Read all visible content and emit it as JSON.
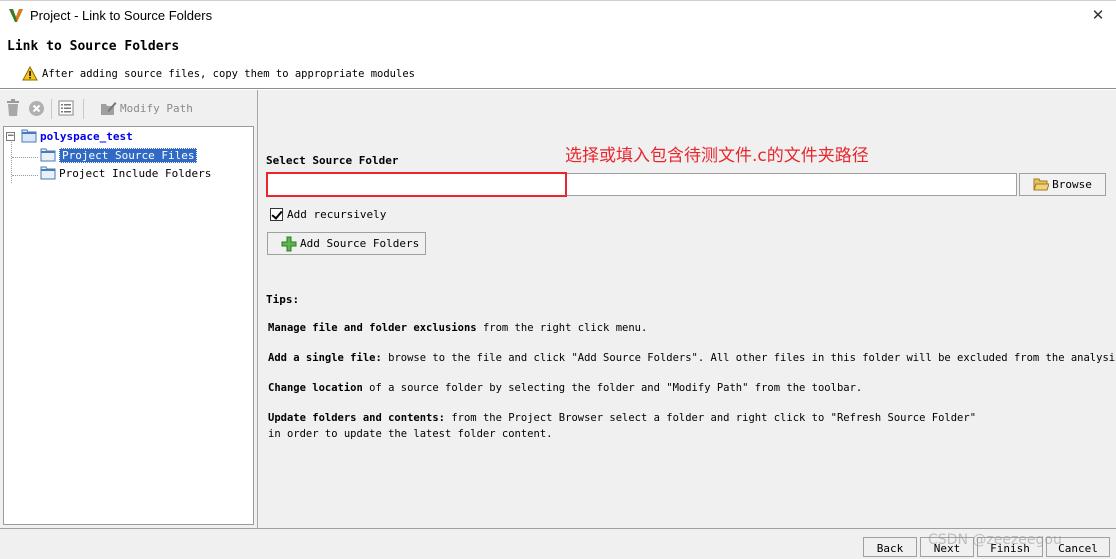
{
  "window": {
    "title": "Project - Link to Source Folders",
    "close_glyph": "✕"
  },
  "banner": {
    "heading": "Link to Source Folders",
    "warning": "After adding source files, copy them to appropriate modules"
  },
  "toolbar": {
    "modify_path_label": "Modify Path"
  },
  "tree": {
    "root": "polyspace_test",
    "children": [
      "Project Source Files",
      "Project Include Folders"
    ]
  },
  "form": {
    "select_label": "Select Source Folder",
    "annotation": "选择或填入包含待测文件.c的文件夹路径",
    "path_value": "",
    "browse_label": "Browse",
    "recursive_label": "Add recursively",
    "recursive_checked": true,
    "add_button_label": "Add Source Folders"
  },
  "tips": {
    "title": "Tips:",
    "items": [
      {
        "bold": "Manage file and folder exclusions",
        "text": " from the right click menu."
      },
      {
        "bold": "Add a single file:",
        "text": " browse to the file and click \"Add Source Folders\". All other files in this folder will be excluded from the analysis."
      },
      {
        "bold": "Change location",
        "text": " of a source folder by selecting the folder and \"Modify Path\" from the toolbar."
      },
      {
        "bold": "Update folders and contents:",
        "text": " from the Project Browser select a folder and right click to \"Refresh Source Folder\""
      },
      {
        "bold": "",
        "text": "in order to update the latest folder content."
      }
    ]
  },
  "footer": {
    "back": "Back",
    "next": "Next",
    "finish": "Finish",
    "cancel": "Cancel",
    "watermark": "CSDN @zeezeegou"
  },
  "colors": {
    "annotation": "#e8262c",
    "selection": "#316ac5",
    "root_link": "#0000ee",
    "add_icon": "#3fa83f"
  }
}
